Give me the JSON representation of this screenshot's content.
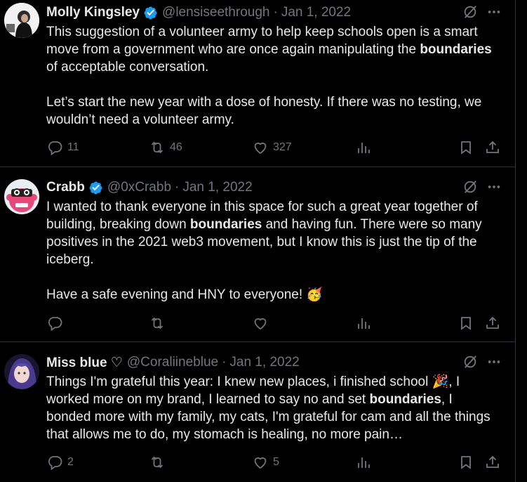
{
  "tweets": [
    {
      "name": "Molly Kingsley",
      "verified": true,
      "handle": "@lensiseethrough",
      "date": "Jan 1, 2022",
      "text": {
        "p1_a": "This suggestion of a volunteer army to help keep schools open is a smart move from a government who are once again manipulating the ",
        "p1_b": "boundaries",
        "p1_c": " of acceptable conversation.",
        "p2": "Let’s start the new year with a dose of honesty. If there was no testing, we wouldn’t need a volunteer army."
      },
      "replies": "11",
      "retweets": "46",
      "likes": "327"
    },
    {
      "name": "Crabb",
      "verified": true,
      "handle": "@0xCrabb",
      "date": "Jan 1, 2022",
      "text": {
        "p1_a": "I wanted to thank everyone in this space for such a great year together of building, breaking down ",
        "p1_b": "boundaries",
        "p1_c": " and having fun. There were so many positives in the 2021 web3 movement, but I know this is just the tip of the iceberg.",
        "p2": "Have a safe evening and HNY to everyone! 🥳"
      },
      "replies": "",
      "retweets": "",
      "likes": ""
    },
    {
      "name": "Miss blue ♡",
      "verified": false,
      "handle": "@Coraliineblue",
      "date": "Jan 1, 2022",
      "text": {
        "p1_a": "Things I'm grateful this year: I knew new places, i finished school 🎉, I worked more on my brand, I learned to say no and set ",
        "p1_b": "boundaries",
        "p1_c": ", I bonded more with my family, my cats, I'm grateful for cam and all the things that allows me to do, my stomach is healing, no more pain…",
        "p2": ""
      },
      "replies": "2",
      "retweets": "",
      "likes": "5"
    }
  ],
  "separator": "·",
  "colors": {
    "background": "#000000",
    "text": "#e7e9ea",
    "muted": "#71767b",
    "verified": "#1d9bf0",
    "border": "#2f3336"
  },
  "icons": [
    "grok-icon",
    "more-icon",
    "reply-icon",
    "retweet-icon",
    "like-icon",
    "views-icon",
    "bookmark-icon",
    "share-icon",
    "verified-icon"
  ]
}
